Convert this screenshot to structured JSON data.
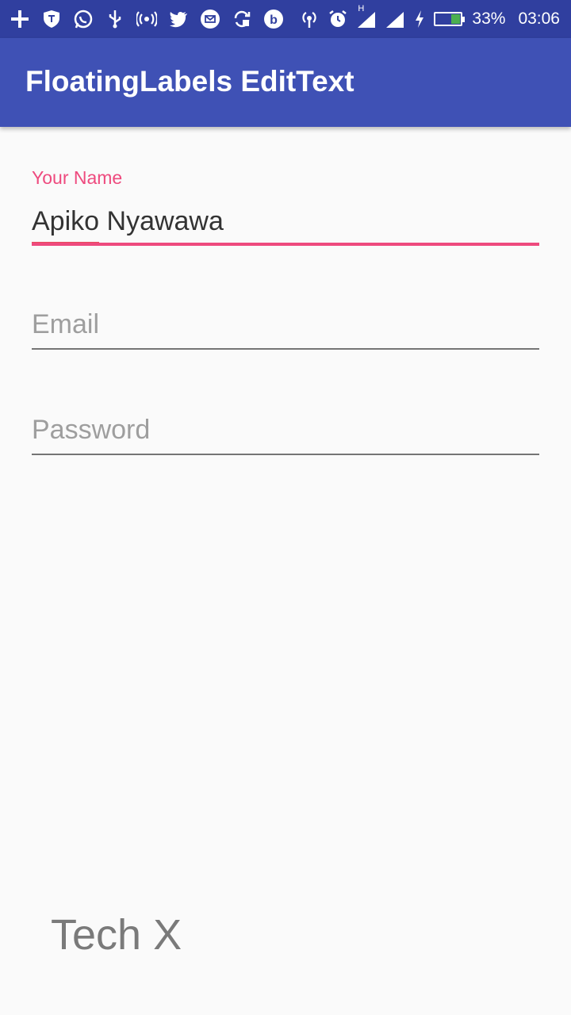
{
  "status_bar": {
    "battery": "33%",
    "time": "03:06",
    "network_type": "H",
    "left_icons": [
      "plus-icon",
      "shield-icon",
      "whatsapp-icon",
      "usb-icon",
      "hotspot-icon",
      "twitter-icon",
      "message-icon",
      "sync-icon",
      "b-app-icon"
    ],
    "right_icons": [
      "hotspot-tethering-icon",
      "alarm-icon",
      "signal-icon",
      "signal-icon-2",
      "charging-icon",
      "battery-icon"
    ],
    "colors": {
      "background": "#303f9f",
      "battery_fill": "#4caf50"
    }
  },
  "app_bar": {
    "title": "FloatingLabels EditText",
    "color": "#3f51b5"
  },
  "form": {
    "name_field": {
      "label": "Your Name",
      "value_first": "Apiko",
      "value_rest": " Nyawawa",
      "focused": true,
      "accent_color": "#ee4a7e"
    },
    "email_field": {
      "placeholder": "Email",
      "value": ""
    },
    "password_field": {
      "placeholder": "Password",
      "value": ""
    }
  },
  "footer": {
    "text": "Tech X"
  }
}
